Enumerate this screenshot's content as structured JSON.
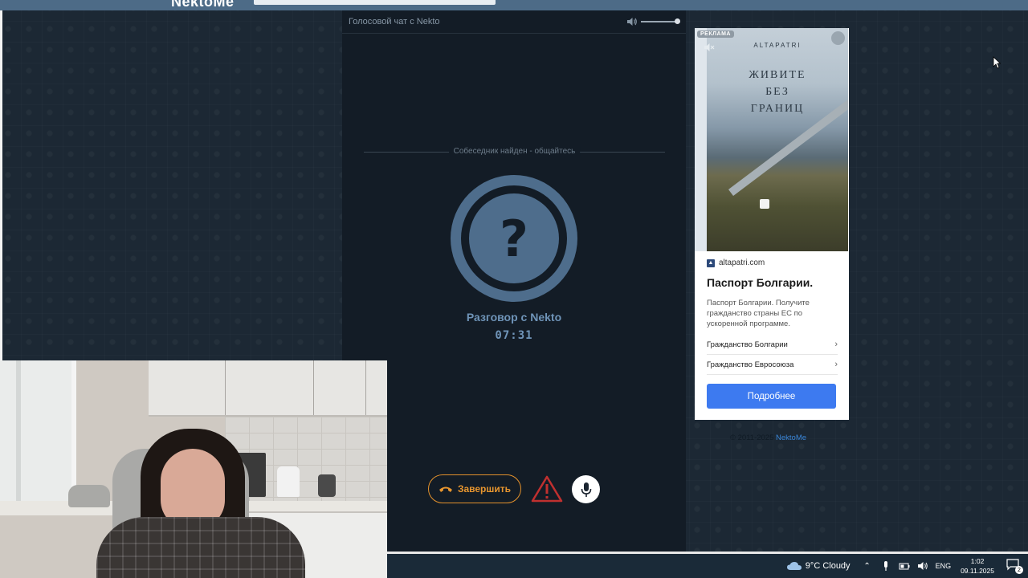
{
  "header": {
    "logo": "NektoMe"
  },
  "chat": {
    "title": "Голосовой чат с Nekto",
    "status": "Собеседник найден - общайтесь",
    "avatar_icon": "question-mark-icon",
    "conversation_title": "Разговор с Nekto",
    "timer": "07:31",
    "volume_level": 0.95,
    "end_button_label": "Завершить",
    "colors": {
      "accent_orange": "#e3912c",
      "avatar_blue": "#4e6d8c",
      "warning_red": "#c0302f"
    }
  },
  "ad": {
    "label": "РЕКЛАМА",
    "brand": "ALTAPATRI",
    "slogan_lines": [
      "ЖИВИТЕ",
      "БЕЗ",
      "ГРАНИЦ"
    ],
    "domain": "altapatri.com",
    "headline": "Паспорт Болгарии.",
    "description": "Паспорт Болгарии. Получите гражданство страны ЕС по ускоренной программе.",
    "links": [
      "Гражданство Болгарии",
      "Гражданство Евросоюза"
    ],
    "cta": "Подробнее"
  },
  "footer": {
    "copyright": "© 2011-2025",
    "site": "NektoMe"
  },
  "taskbar": {
    "weather": "9°C  Cloudy",
    "language": "ENG",
    "time": "1:02",
    "date": "09.11.2025",
    "notifications": "2"
  }
}
